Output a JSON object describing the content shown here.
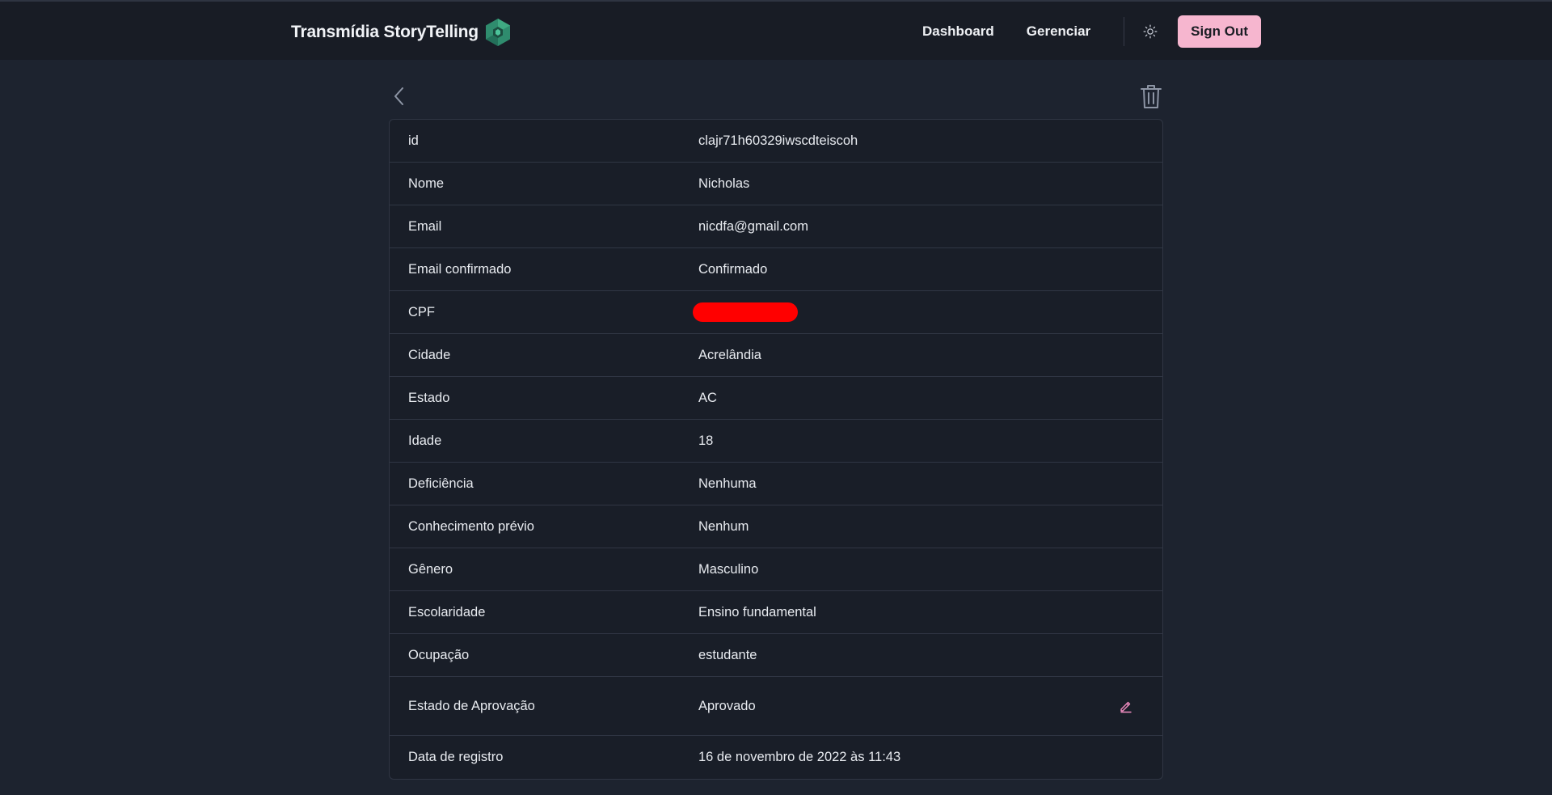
{
  "header": {
    "brand": "Transmídia StoryTelling",
    "nav": [
      {
        "label": "Dashboard"
      },
      {
        "label": "Gerenciar"
      }
    ],
    "sign_out_label": "Sign Out",
    "theme_icon": "sun-icon"
  },
  "toolbar": {
    "back_icon": "chevron-left-icon",
    "delete_icon": "trash-icon"
  },
  "details": [
    {
      "label": "id",
      "value": "clajr71h60329iwscdteiscoh"
    },
    {
      "label": "Nome",
      "value": "Nicholas"
    },
    {
      "label": "Email",
      "value": "nicdfa@gmail.com"
    },
    {
      "label": "Email confirmado",
      "value": "Confirmado"
    },
    {
      "label": "CPF",
      "value": ""
    },
    {
      "label": "Cidade",
      "value": "Acrelândia"
    },
    {
      "label": "Estado",
      "value": "AC"
    },
    {
      "label": "Idade",
      "value": "18"
    },
    {
      "label": "Deficiência",
      "value": "Nenhuma"
    },
    {
      "label": "Conhecimento prévio",
      "value": "Nenhum"
    },
    {
      "label": "Gênero",
      "value": "Masculino"
    },
    {
      "label": "Escolaridade",
      "value": "Ensino fundamental"
    },
    {
      "label": "Ocupação",
      "value": "estudante"
    },
    {
      "label": "Estado de Aprovação",
      "value": "Aprovado"
    },
    {
      "label": "Data de registro",
      "value": "16 de novembro de 2022 às 11:43"
    }
  ],
  "colors": {
    "background": "#1d232f",
    "header_bg": "#181c25",
    "accent_pink": "#f6b6cf",
    "logo_green": "#2f8c6e",
    "redaction": "#ff0000"
  }
}
